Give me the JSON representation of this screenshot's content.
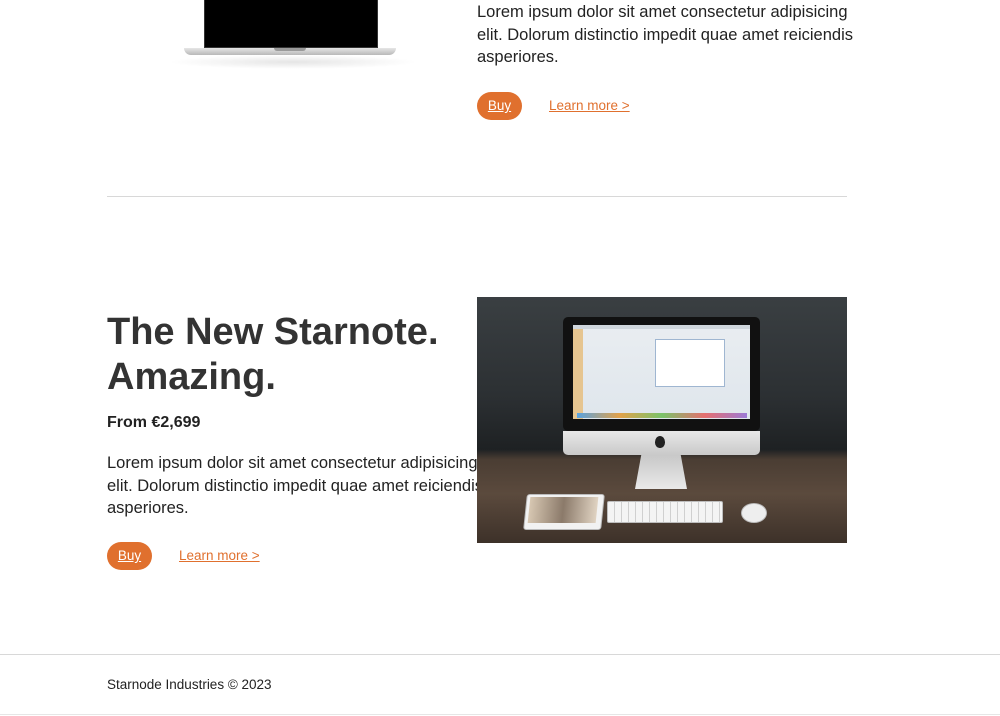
{
  "top_product": {
    "description": "Lorem ipsum dolor sit amet consectetur adipisicing elit. Dolorum distinctio impedit quae amet reiciendis asperiores.",
    "buy_label": "Buy",
    "learn_more_label": "Learn more >"
  },
  "featured_product": {
    "headline_line1": "The New Starnote.",
    "headline_line2": "Amazing.",
    "price": "From €2,699",
    "description": "Lorem ipsum dolor sit amet consectetur adipisicing elit. Dolorum distinctio impedit quae amet reiciendis asperiores.",
    "buy_label": "Buy",
    "learn_more_label": "Learn more >"
  },
  "footer": {
    "copyright": "Starnode Industries © 2023"
  },
  "colors": {
    "accent": "#e0702e",
    "text": "#222222",
    "divider": "#d8d8d8"
  }
}
